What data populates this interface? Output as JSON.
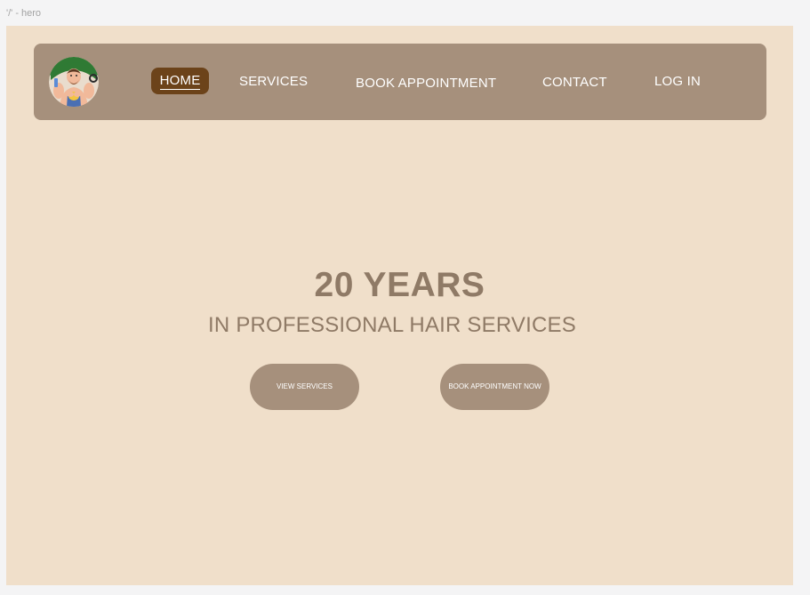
{
  "frame_label": "'/' - hero",
  "nav": {
    "items": [
      {
        "label": "HOME",
        "active": true
      },
      {
        "label": "SERVICES"
      },
      {
        "label": "BOOK APPOINTMENT"
      },
      {
        "label": "CONTACT"
      },
      {
        "label": "LOG IN"
      }
    ]
  },
  "hero": {
    "title": "20 YEARS",
    "subtitle": "IN PROFESSIONAL HAIR SERVICES",
    "buttons": {
      "view_services": "VIEW SERVICES",
      "book_now": "BOOK APPOINTMENT NOW"
    }
  },
  "colors": {
    "background": "#f0dfca",
    "navbar": "#a6907c",
    "active_nav": "#6c431a",
    "hero_text": "#8f7a66",
    "button": "#a6907c"
  },
  "icons": {
    "logo": "barber-avatar-logo"
  }
}
